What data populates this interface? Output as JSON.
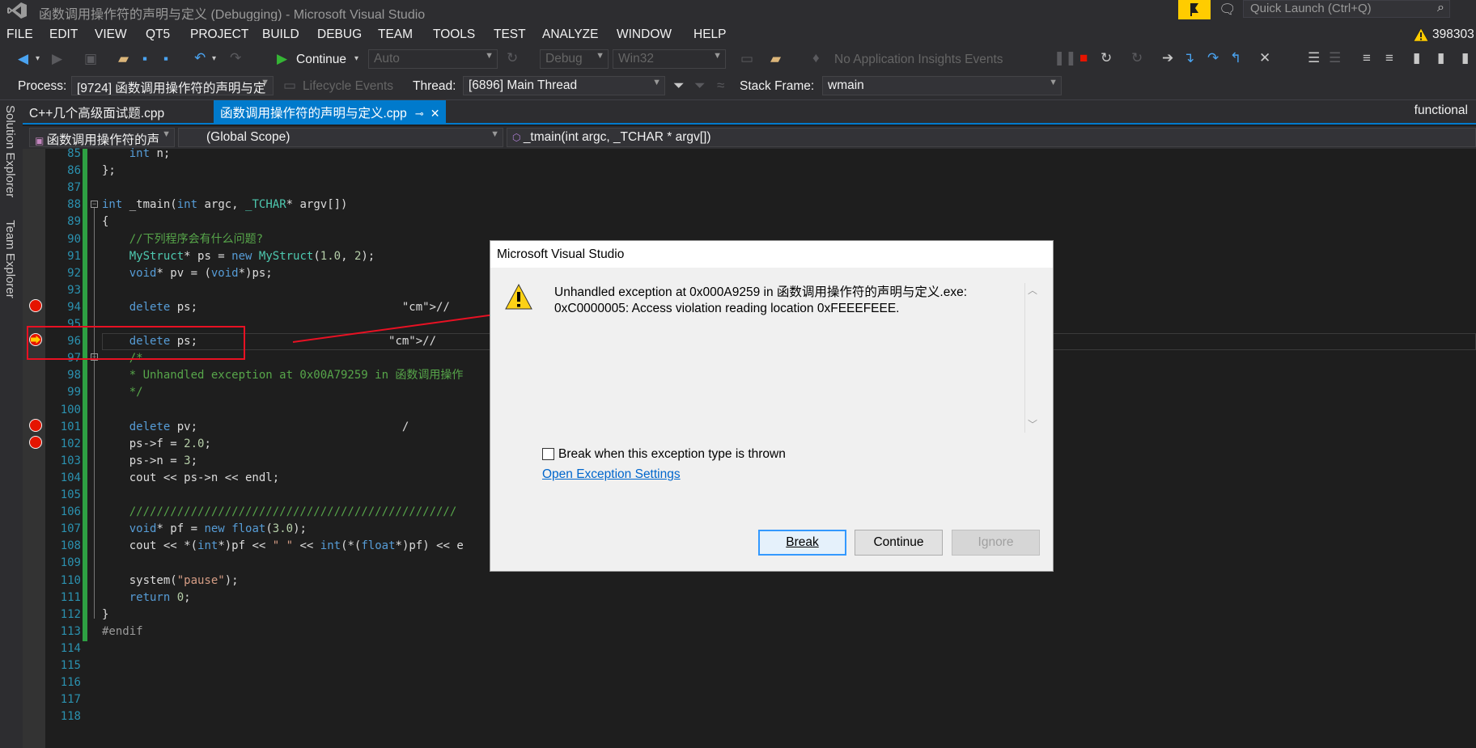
{
  "window": {
    "title": "函数调用操作符的声明与定义 (Debugging) - Microsoft Visual Studio"
  },
  "quick_launch": {
    "placeholder": "Quick Launch (Ctrl+Q)"
  },
  "menu": [
    "FILE",
    "EDIT",
    "VIEW",
    "QT5",
    "PROJECT",
    "BUILD",
    "DEBUG",
    "TEAM",
    "TOOLS",
    "TEST",
    "ANALYZE",
    "WINDOW",
    "HELP"
  ],
  "notifications": {
    "count": "398303"
  },
  "toolbar1": {
    "continue_label": "Continue",
    "auto_combo": "Auto",
    "config_combo": "Debug",
    "platform_combo": "Win32",
    "insights_label": "No Application Insights Events"
  },
  "toolbar2": {
    "process_label": "Process:",
    "process_value": "[9724] 函数调用操作符的声明与定",
    "lifecycle_label": "Lifecycle Events",
    "thread_label": "Thread:",
    "thread_value": "[6896] Main Thread",
    "stackframe_label": "Stack Frame:",
    "stackframe_value": "wmain"
  },
  "side_tabs": [
    "Solution Explorer",
    "Team Explorer"
  ],
  "doc_tabs": {
    "tab1": "C++几个高级面试题.cpp",
    "tab2": "函数调用操作符的声明与定义.cpp",
    "right": "functional"
  },
  "navbar": {
    "project": "函数调用操作符的声",
    "scope": "(Global Scope)",
    "member": "_tmain(int argc, _TCHAR * argv[])"
  },
  "code_lines": [
    {
      "n": "85",
      "t": "    int n;"
    },
    {
      "n": "86",
      "t": "};"
    },
    {
      "n": "87",
      "t": ""
    },
    {
      "n": "88",
      "t": "int _tmain(int argc, _TCHAR* argv[])"
    },
    {
      "n": "89",
      "t": "{"
    },
    {
      "n": "90",
      "t": "    //下列程序会有什么问题?"
    },
    {
      "n": "91",
      "t": "    MyStruct* ps = new MyStruct(1.0, 2);"
    },
    {
      "n": "92",
      "t": "    void* pv = (void*)ps;"
    },
    {
      "n": "93",
      "t": ""
    },
    {
      "n": "94",
      "t": "    delete ps;                              //"
    },
    {
      "n": "95",
      "t": ""
    },
    {
      "n": "96",
      "t": "    delete ps;                            //"
    },
    {
      "n": "97",
      "t": "    /*"
    },
    {
      "n": "98",
      "t": "    * Unhandled exception at 0x00A79259 in 函数调用操作"
    },
    {
      "n": "99",
      "t": "    */"
    },
    {
      "n": "100",
      "t": ""
    },
    {
      "n": "101",
      "t": "    delete pv;                              /"
    },
    {
      "n": "102",
      "t": "    ps->f = 2.0;"
    },
    {
      "n": "103",
      "t": "    ps->n = 3;"
    },
    {
      "n": "104",
      "t": "    cout << ps->n << endl;"
    },
    {
      "n": "105",
      "t": ""
    },
    {
      "n": "106",
      "t": "    ////////////////////////////////////////////////"
    },
    {
      "n": "107",
      "t": "    void* pf = new float(3.0);"
    },
    {
      "n": "108",
      "t": "    cout << *(int*)pf << \" \" << int(*(float*)pf) << e"
    },
    {
      "n": "109",
      "t": ""
    },
    {
      "n": "110",
      "t": "    system(\"pause\");"
    },
    {
      "n": "111",
      "t": "    return 0;"
    },
    {
      "n": "112",
      "t": "}"
    },
    {
      "n": "113",
      "t": "#endif"
    },
    {
      "n": "114",
      "t": ""
    },
    {
      "n": "115",
      "t": ""
    },
    {
      "n": "116",
      "t": ""
    },
    {
      "n": "117",
      "t": ""
    },
    {
      "n": "118",
      "t": ""
    }
  ],
  "dialog": {
    "title": "Microsoft Visual Studio",
    "message_line1": "Unhandled exception at 0x000A9259 in 函数调用操作符的声明与定义.exe:",
    "message_line2": "0xC0000005: Access violation reading location 0xFEEEFEEE.",
    "checkbox_label": "Break when this exception type is thrown",
    "link_label": "Open Exception Settings",
    "break_label": "Break",
    "continue_label": "Continue",
    "ignore_label": "Ignore"
  },
  "colors": {
    "accent": "#007acc",
    "breakpoint": "#e51400",
    "highlight_box": "#e81123",
    "warning": "#ffcc00"
  }
}
